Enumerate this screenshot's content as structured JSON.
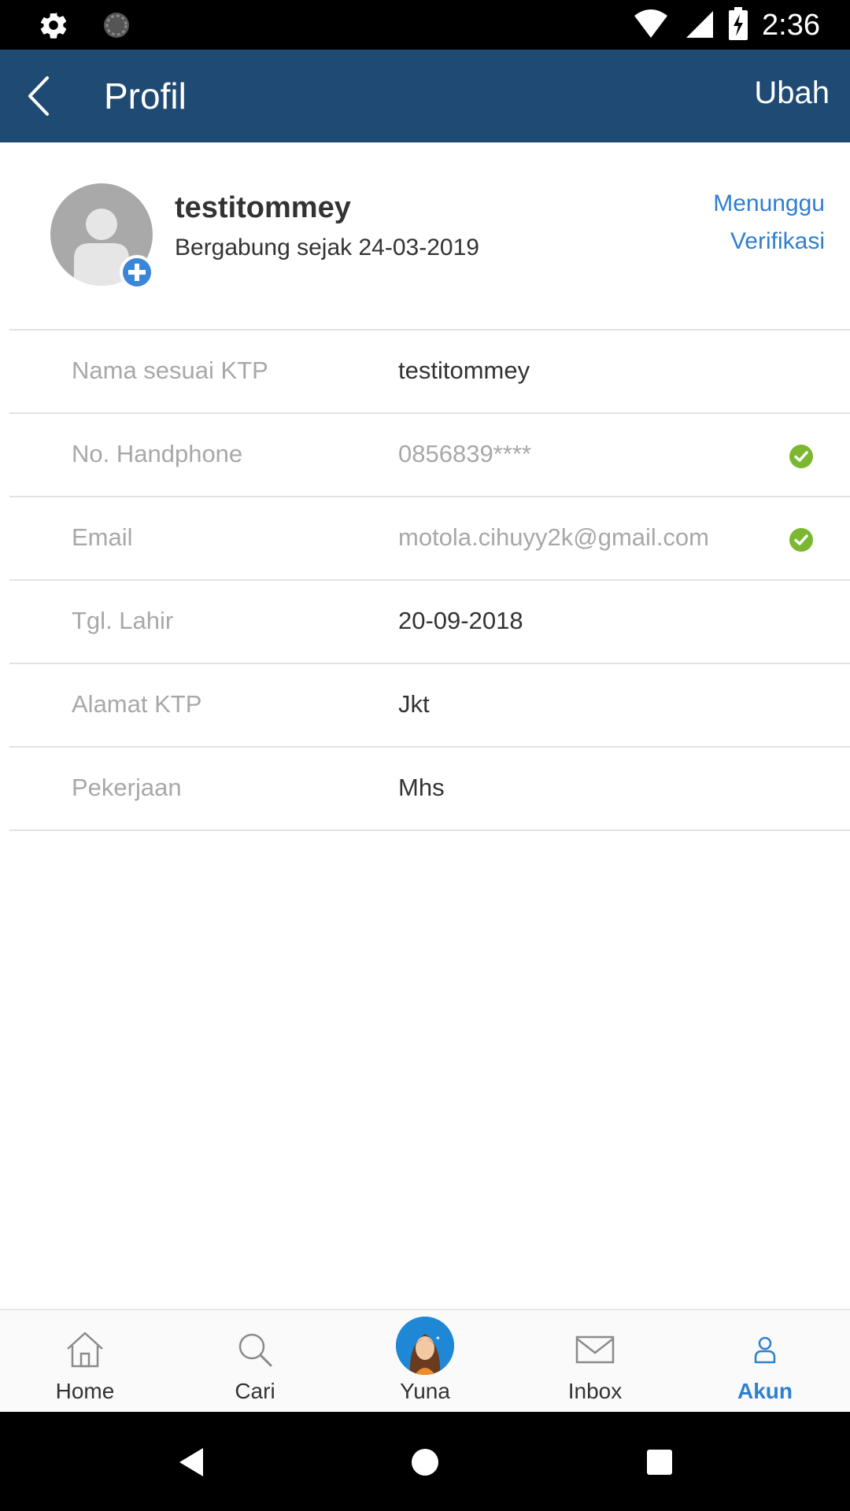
{
  "status_bar": {
    "time": "2:36",
    "icons": [
      "gear-icon",
      "sync-icon",
      "wifi-icon",
      "signal-icon",
      "battery-charging-icon"
    ]
  },
  "app_bar": {
    "title": "Profil",
    "back_icon": "chevron-left-icon",
    "edit_label": "Ubah"
  },
  "profile": {
    "username": "testitommey",
    "joined": "Bergabung sejak 24-03-2019",
    "verification_line1": "Menunggu",
    "verification_line2": "Verifikasi"
  },
  "info_rows": [
    {
      "label": "Nama sesuai KTP",
      "value": "testitommey",
      "verified": false
    },
    {
      "label": "No. Handphone",
      "value": "0856839****",
      "verified": true
    },
    {
      "label": "Email",
      "value": "motola.cihuyy2k@gmail.com",
      "verified": true
    },
    {
      "label": "Tgl. Lahir",
      "value": "20-09-2018",
      "verified": false
    },
    {
      "label": "Alamat KTP",
      "value": "Jkt",
      "verified": false
    },
    {
      "label": "Pekerjaan",
      "value": "Mhs",
      "verified": false
    }
  ],
  "bottom_nav": {
    "items": [
      {
        "label": "Home",
        "icon": "home-icon",
        "active": false
      },
      {
        "label": "Cari",
        "icon": "search-icon",
        "active": false
      },
      {
        "label": "Yuna",
        "icon": "yuna-avatar-icon",
        "active": false
      },
      {
        "label": "Inbox",
        "icon": "mail-icon",
        "active": false
      },
      {
        "label": "Akun",
        "icon": "user-icon",
        "active": true
      }
    ]
  },
  "colors": {
    "app_bar": "#1e4a73",
    "accent": "#2f7fd1",
    "verified": "#7cb82f",
    "muted_text": "#a8a8a8"
  }
}
